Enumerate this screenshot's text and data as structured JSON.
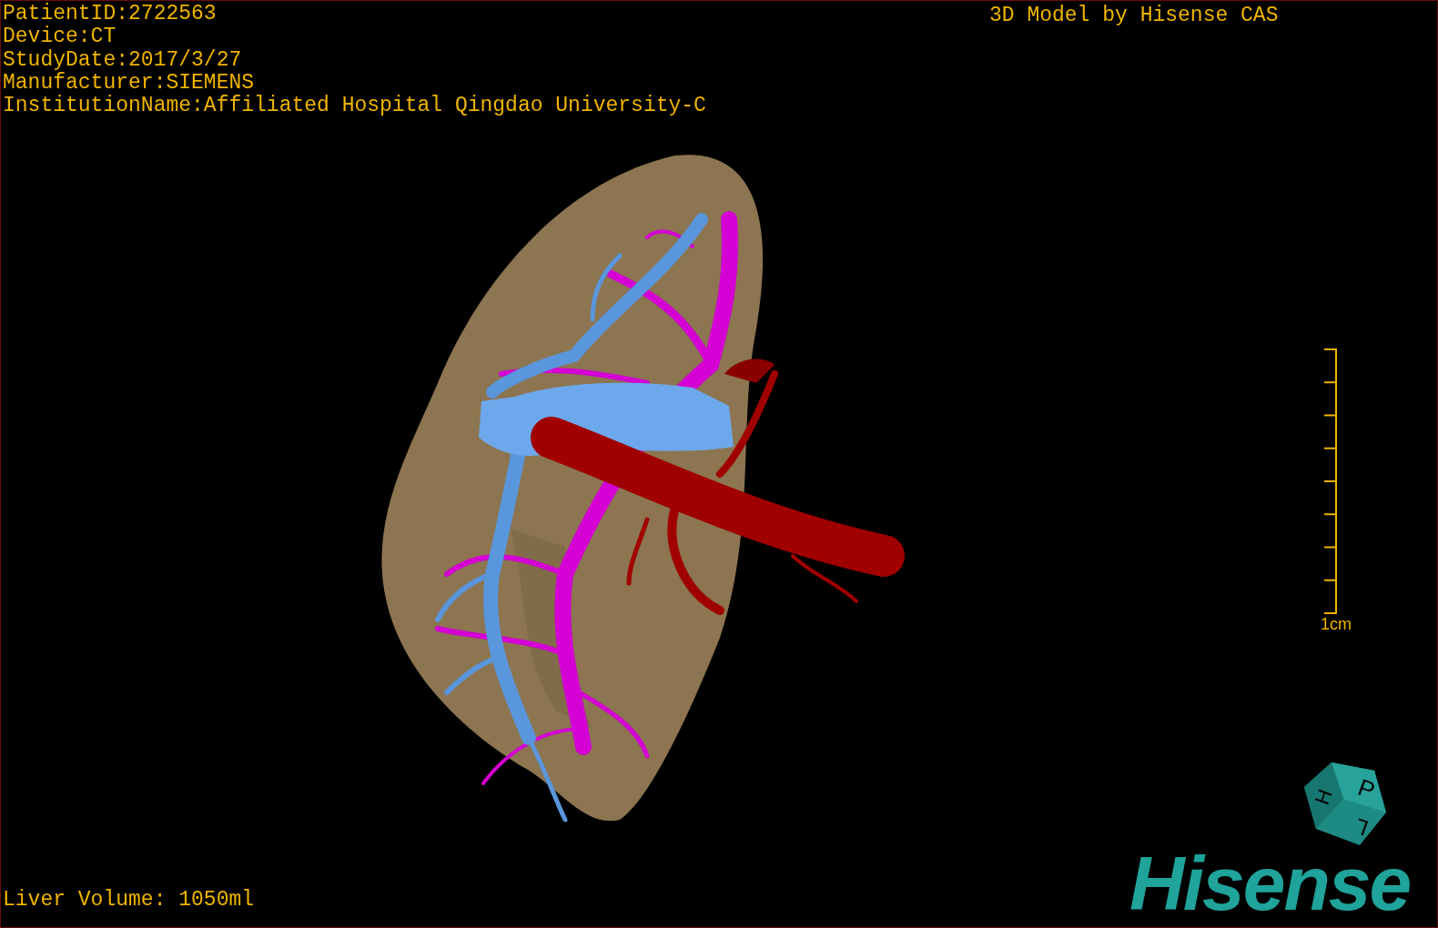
{
  "info_lines": [
    "PatientID:2722563",
    "Device:CT",
    "StudyDate:2017/3/27",
    "Manufacturer:SIEMENS",
    "InstitutionName:Affiliated Hospital Qingdao University-C"
  ],
  "title_overlay": "3D Model by Hisense CAS",
  "scale_bar": {
    "label": "1cm"
  },
  "orientation_cube": {
    "faces": [
      "P",
      "H",
      "L"
    ]
  },
  "logo": "Hisense",
  "liver_volume": "Liver Volume: 1050ml"
}
